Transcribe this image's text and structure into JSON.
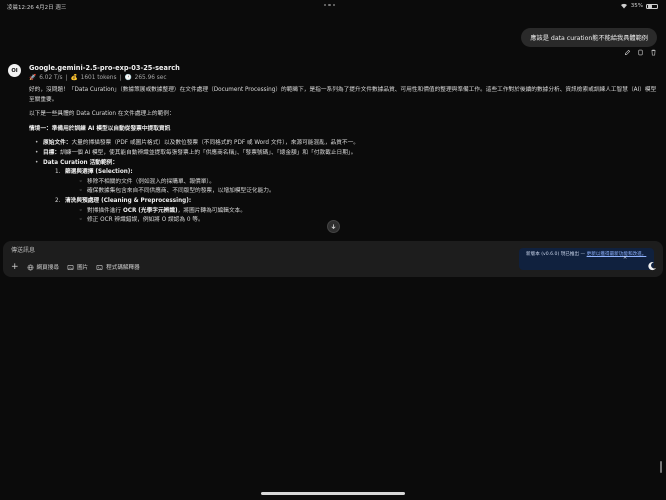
{
  "status_bar": {
    "time_date": "凌晨12:26   4月2日 週三",
    "battery": "35%"
  },
  "user_message": {
    "text": "應該是 data curation能不能給我具體範例"
  },
  "assistant": {
    "avatar_text": "OI",
    "model": "Google.gemini-2.5-pro-exp-03-25-search",
    "stats": {
      "rate_icon": "🚀",
      "rate": "6.02 T/s",
      "tokens_icon": "💰",
      "tokens": "1601 tokens",
      "time_icon": "🕐",
      "time": "265.96 sec"
    },
    "intro": "好的，沒問題！「Data Curation」（數據策展或數據整理）在文件處理（Document Processing）的範疇下，是指一系列為了提升文件數據品質、可用性和價值的整理與準備工作。這些工作對於後續的數據分析、資訊檢索或訓練人工智慧（AI）模型至關重要。",
    "lead": "以下是一些具體的 Data Curation 在文件處理上的範例：",
    "scenario_title": "情境一：準備用於訓練 AI 模型以自動從發票中提取資訊",
    "bullets": [
      {
        "label": "原始文件：",
        "text": "大量的掃描發票（PDF 或圖片格式）以及數位發票（不同格式的 PDF 或 Word 文件），來源可能混亂，品質不一。"
      },
      {
        "label": "目標：",
        "text": "訓練一個 AI 模型，使其能自動辨識並提取每張發票上的「供應商名稱」、「發票號碼」、「總金額」和「付款截止日期」。"
      },
      {
        "label": "Data Curation 活動範例：",
        "text": ""
      }
    ],
    "steps": [
      {
        "num": "1.",
        "title": "篩選與選擇 (Selection):",
        "items": [
          "移除不相關的文件（例如混入的採購單、報價單）。",
          "確保數據集包含來自不同供應商、不同版型的發票，以增加模型泛化能力。"
        ]
      },
      {
        "num": "2.",
        "title": "清洗與預處理 (Cleaning & Preprocessing):",
        "items": [
          {
            "pre": "對掃描件進行 ",
            "bold": "OCR (光學字元辨識)",
            "post": "，將圖片轉為可編輯文本。"
          },
          {
            "pre": "修正 OCR 辨識錯誤，例如將 O 誤認為 0 等。",
            "bold": "",
            "post": ""
          }
        ]
      }
    ]
  },
  "composer": {
    "placeholder": "傳送訊息",
    "tools": {
      "web_search": "網頁搜尋",
      "image": "圖片",
      "code_interpreter": "程式碼解釋器"
    }
  },
  "toast": {
    "text": "新版本 (v0.6.0) 現已推出 — ",
    "link": "更新以獲得最新功能和改進。",
    "close": "✕"
  }
}
